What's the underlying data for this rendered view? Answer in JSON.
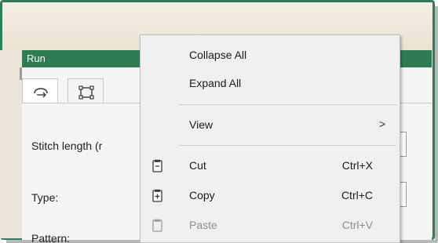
{
  "panel": {
    "title": "Run",
    "tabs": [
      {
        "icon": "run-path-icon"
      },
      {
        "icon": "bounding-box-icon"
      }
    ],
    "fields": [
      {
        "label": "Stitch length (r"
      },
      {
        "label": "Type:"
      },
      {
        "label": "Pattern:"
      }
    ]
  },
  "context_menu": {
    "items": [
      {
        "label": "Collapse All"
      },
      {
        "label": "Expand All"
      },
      {
        "label": "View",
        "submenu": ">"
      },
      {
        "label": "Cut",
        "shortcut": "Ctrl+X",
        "icon": "cut-icon"
      },
      {
        "label": "Copy",
        "shortcut": "Ctrl+C",
        "icon": "copy-icon"
      },
      {
        "label": "Paste",
        "shortcut": "Ctrl+V",
        "icon": "paste-icon",
        "disabled": true
      }
    ]
  },
  "colors": {
    "accent_green": "#2e7d52",
    "frame_green": "#2f7d5a",
    "disabled_text": "#8e8e8e"
  }
}
